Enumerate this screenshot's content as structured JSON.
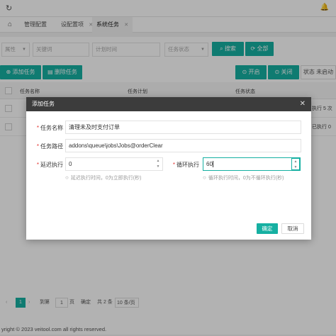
{
  "topbar": {
    "refresh_icon": "refresh-icon",
    "bell_icon": "bell-icon"
  },
  "tabs": [
    {
      "label": "管理配置"
    },
    {
      "label": "设配置项"
    },
    {
      "label": "系统任务"
    }
  ],
  "filters": {
    "attr_placeholder": "属性",
    "keyword_placeholder": "关键词",
    "time_placeholder": "计划时间",
    "status_placeholder": "任务状态",
    "search_label": "搜索",
    "all_label": "全部"
  },
  "toolbar": {
    "add_label": "添加任务",
    "delete_label": "删除任务",
    "start_label": "开启",
    "stop_label": "关闭",
    "status_text": "状态 未启动"
  },
  "table": {
    "headers": [
      "任务名称",
      "任务计划",
      "任务状态"
    ],
    "row_fragments": [
      "执行 5 次",
      "已执行 0"
    ]
  },
  "pager": {
    "current": "1",
    "goto": "到第",
    "page_input": "1",
    "page_unit": "页",
    "confirm": "确定",
    "total": "共 2 条",
    "page_size": "10 条/页"
  },
  "footer": {
    "text": "yright © 2023 veitool.com all rights reserved."
  },
  "modal": {
    "title": "添加任务",
    "name_label": "任务名称",
    "name_value": "清理未及时支付订单",
    "path_label": "任务路径",
    "path_value": "addons\\queue\\jobs\\Jobs@orderClear",
    "delay_label": "延迟执行",
    "delay_value": "0",
    "delay_hint": "延迟执行时间，0为立即执行(秒)",
    "loop_label": "循环执行",
    "loop_value": "60",
    "loop_hint": "循环执行时间，0为不循环执行(秒)",
    "confirm_label": "确定",
    "cancel_label": "取消"
  },
  "colors": {
    "accent": "#16b0a2",
    "modal_header": "#3c3c3c",
    "required": "#e53935"
  }
}
